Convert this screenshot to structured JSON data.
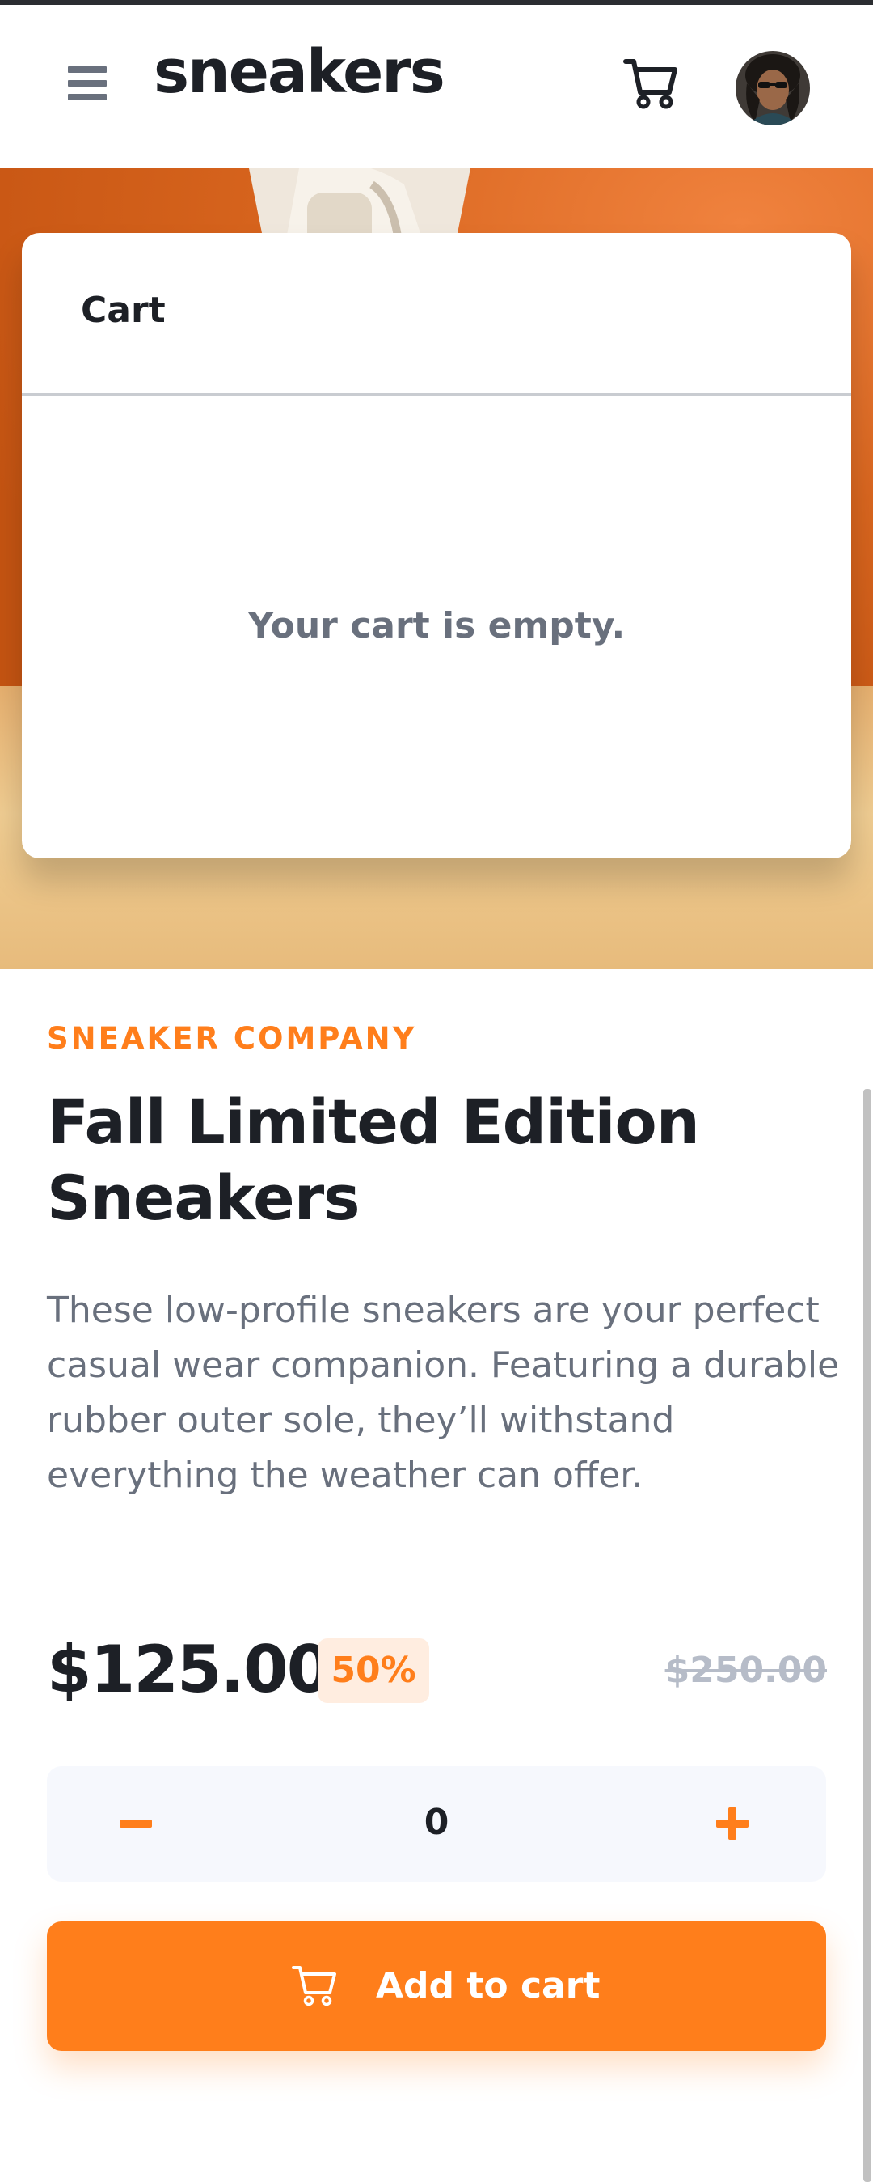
{
  "header": {
    "logo": "sneakers",
    "menu_icon": "hamburger-icon",
    "cart_icon": "cart-icon",
    "avatar_alt": "user-avatar"
  },
  "cart": {
    "title": "Cart",
    "empty_message": "Your cart is empty."
  },
  "product": {
    "brand": "SNEAKER COMPANY",
    "title": "Fall Limited Edition Sneakers",
    "description": "These low-profile sneakers are your perfect casual wear companion. Featuring a durable rubber outer sole, they’ll withstand everything the weather can offer.",
    "price": "$125.00",
    "discount": "50%",
    "original_price": "$250.00"
  },
  "quantity": {
    "value": "0",
    "minus_icon": "minus-icon",
    "plus_icon": "plus-icon"
  },
  "add_to_cart": {
    "label": "Add to cart",
    "icon": "cart-icon"
  },
  "colors": {
    "accent": "#ff7e1b",
    "accent_pale": "#ffede0",
    "text_dark": "#1d2026",
    "text_gray": "#69707d",
    "text_light": "#b6bcc8",
    "qty_bg": "#f6f8fd"
  }
}
